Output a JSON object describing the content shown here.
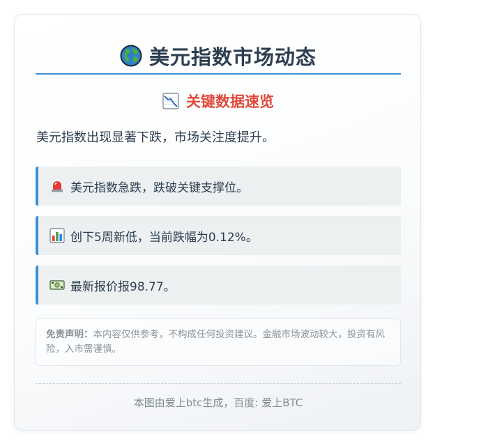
{
  "header": {
    "icon": "globe-icon",
    "title": "美元指数市场动态"
  },
  "section": {
    "icon": "chart-decreasing-icon",
    "title": "关键数据速览"
  },
  "intro": "美元指数出现显著下跌，市场关注度提升。",
  "items": [
    {
      "icon": "siren-icon",
      "text": "美元指数急跌，跌破关键支撑位。"
    },
    {
      "icon": "bar-chart-icon",
      "text": "创下5周新低，当前跌幅为0.12%。"
    },
    {
      "icon": "dollar-banknote-icon",
      "text": "最新报价报98.77。"
    }
  ],
  "disclaimer": {
    "label": "免责声明：",
    "text": "本内容仅供参考，不构成任何投资建议。金融市场波动较大，投资有风险，入市需谨慎。"
  },
  "footer": "本图由爱上btc生成，百度: 爱上BTC",
  "colors": {
    "accent": "#3b8fd4",
    "title": "#2d3e50",
    "highlight": "#e04a3b",
    "item_bg": "#ecf0f1"
  }
}
